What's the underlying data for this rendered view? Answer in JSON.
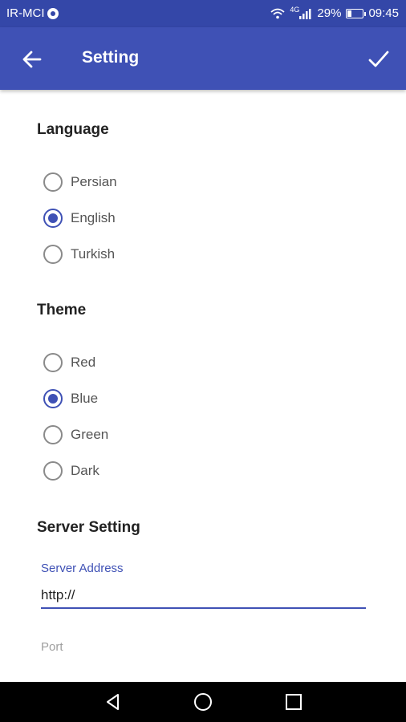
{
  "status_bar": {
    "carrier": "IR-MCI",
    "network_label": "4G",
    "battery": "29%",
    "battery_level": 0.29,
    "time": "09:45"
  },
  "app_bar": {
    "title": "Setting",
    "back_icon": "arrow-back-icon",
    "confirm_icon": "check-icon"
  },
  "language": {
    "title": "Language",
    "options": [
      "Persian",
      "English",
      "Turkish"
    ],
    "selected": "English"
  },
  "theme": {
    "title": "Theme",
    "options": [
      "Red",
      "Blue",
      "Green",
      "Dark"
    ],
    "selected": "Blue"
  },
  "server": {
    "title": "Server Setting",
    "address_label": "Server Address",
    "address_value": "http://",
    "port_label": "Port",
    "port_value": ""
  },
  "colors": {
    "primary": "#3f51b5",
    "status_bar": "#3447a8"
  }
}
